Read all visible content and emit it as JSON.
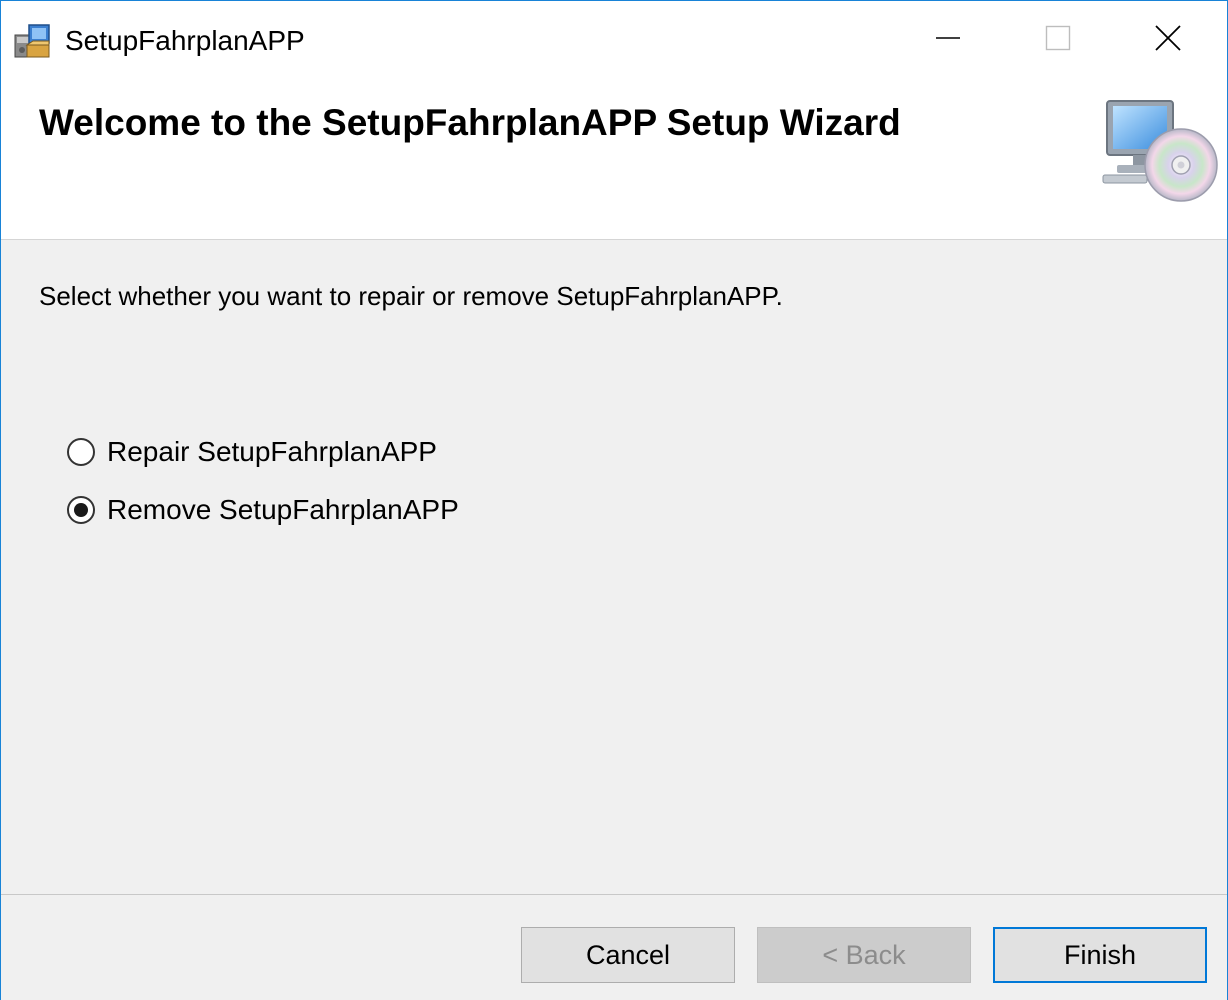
{
  "window": {
    "title": "SetupFahrplanAPP",
    "accent_color": "#0078d7",
    "icons": {
      "app": "installer-package-icon",
      "minimize": "minimize-icon",
      "maximize": "maximize-icon",
      "close": "close-icon",
      "banner": "computer-cd-icon"
    }
  },
  "banner": {
    "title": "Welcome to the SetupFahrplanAPP Setup Wizard"
  },
  "body": {
    "instruction": "Select whether you want to repair or remove SetupFahrplanAPP.",
    "options": [
      {
        "label": "Repair SetupFahrplanAPP",
        "selected": false
      },
      {
        "label": "Remove SetupFahrplanAPP",
        "selected": true
      }
    ]
  },
  "footer": {
    "cancel_label": "Cancel",
    "back_label": "< Back",
    "back_enabled": false,
    "finish_label": "Finish"
  }
}
